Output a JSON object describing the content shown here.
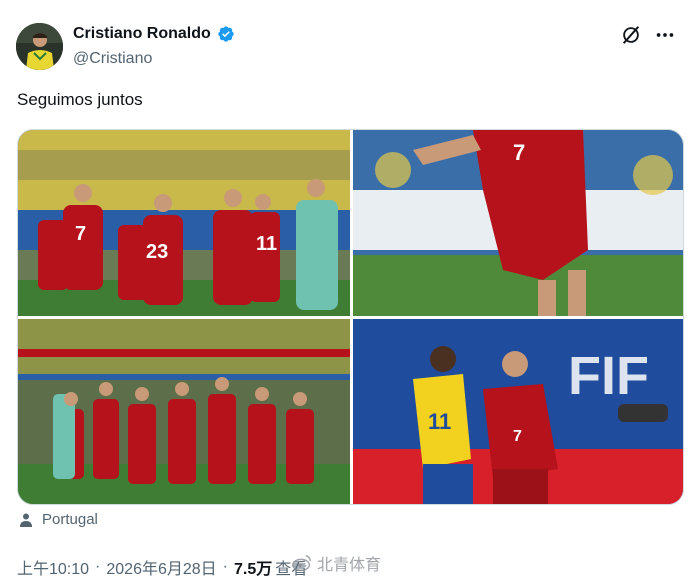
{
  "author": {
    "display_name": "Cristiano Ronaldo",
    "handle": "@Cristiano",
    "verified": true,
    "avatar_icon": "avatar-photo"
  },
  "header_icons": [
    "grok-icon",
    "more-icon"
  ],
  "tweet": {
    "text": "Seguimos juntos"
  },
  "media": {
    "images": [
      {
        "description_icon": "team-photo-1"
      },
      {
        "description_icon": "player-closeup"
      },
      {
        "description_icon": "team-photo-2"
      },
      {
        "description_icon": "match-action"
      }
    ]
  },
  "location": {
    "label": "Portugal",
    "icon": "person-pin-icon"
  },
  "meta": {
    "time": "上午10:10",
    "separator": "·",
    "date": "2026年6月28日",
    "views_count": "7.5万",
    "views_label": "查看"
  },
  "watermark": {
    "text": "北青体育"
  },
  "colors": {
    "verified_blue": "#1d9bf0",
    "text_primary": "#0f1419",
    "text_secondary": "#536471",
    "jersey_red": "#b5121b",
    "pitch_green": "#4f8a3a"
  }
}
